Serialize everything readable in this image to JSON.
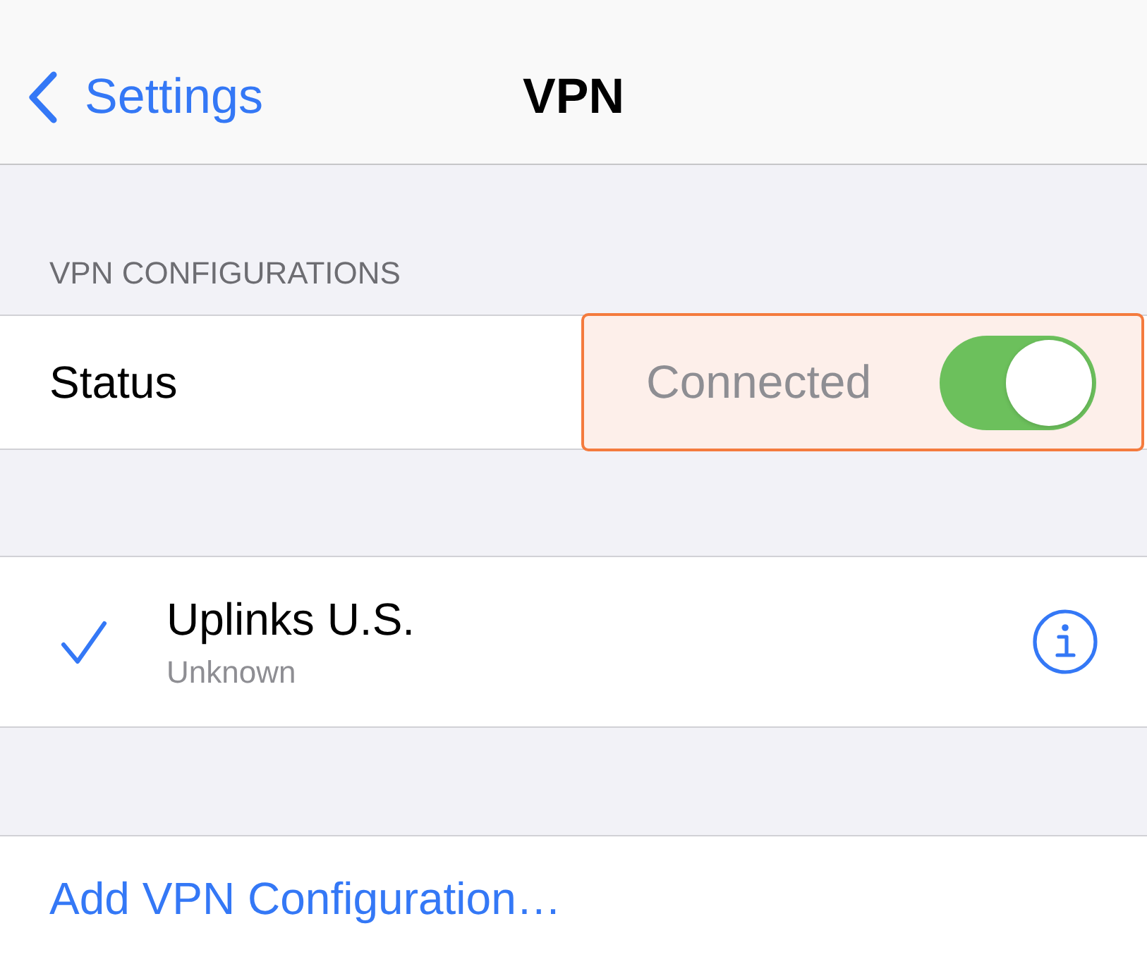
{
  "nav_bar": {
    "back_label": "Settings",
    "title": "VPN"
  },
  "section_header": "VPN CONFIGURATIONS",
  "status_row": {
    "label": "Status",
    "value": "Connected",
    "on": true,
    "highlighted": true
  },
  "configurations": [
    {
      "name": "Uplinks U.S.",
      "detail": "Unknown",
      "selected": true
    }
  ],
  "add_button": {
    "label": "Add VPN Configuration…"
  }
}
